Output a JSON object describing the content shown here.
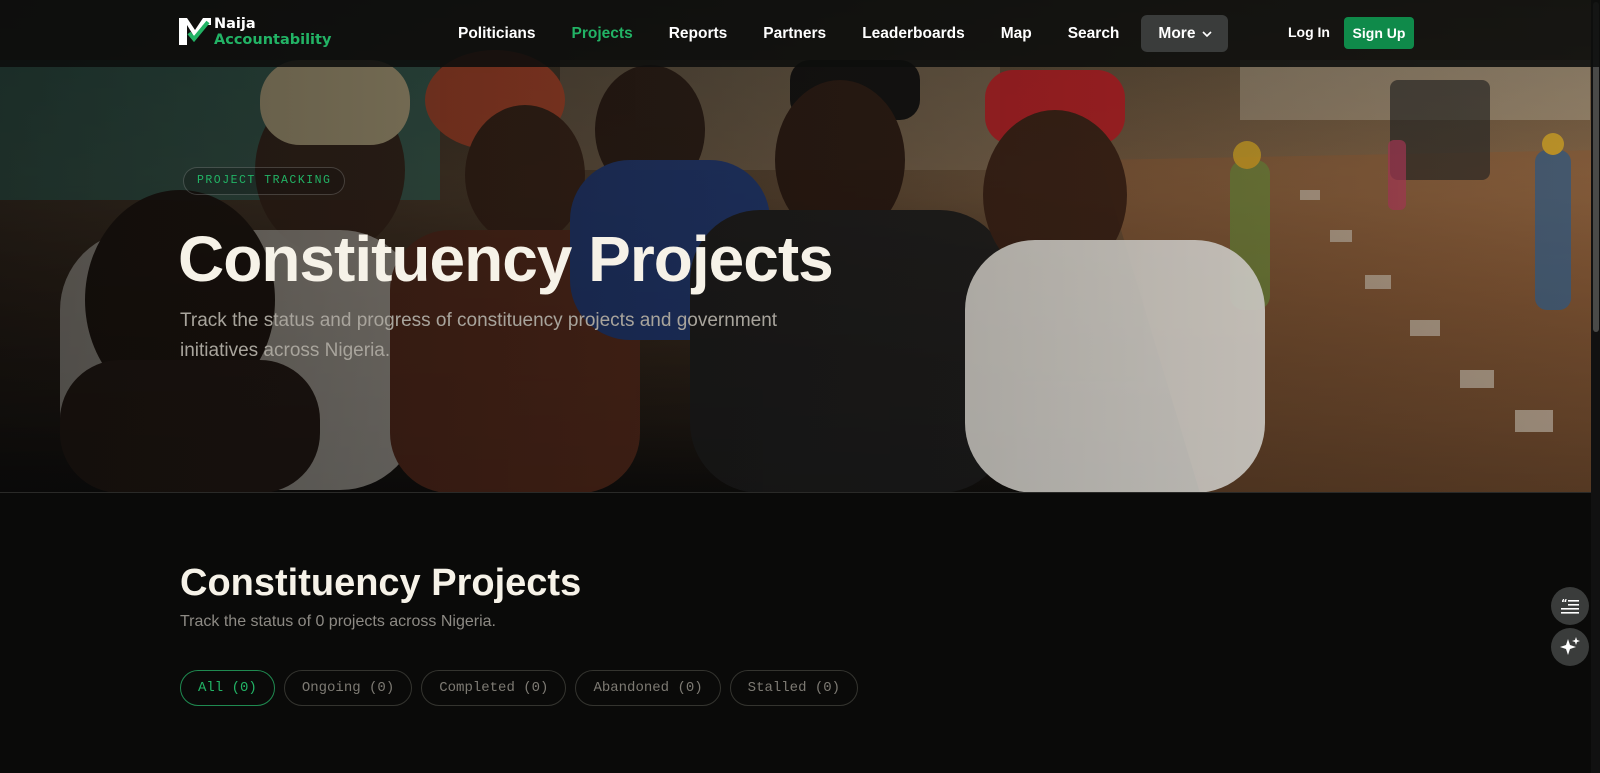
{
  "brand": {
    "line1": "Naija",
    "line2": "Accountability"
  },
  "nav": {
    "links": [
      {
        "label": "Politicians",
        "active": false
      },
      {
        "label": "Projects",
        "active": true
      },
      {
        "label": "Reports",
        "active": false
      },
      {
        "label": "Partners",
        "active": false
      },
      {
        "label": "Leaderboards",
        "active": false
      },
      {
        "label": "Map",
        "active": false
      },
      {
        "label": "Search",
        "active": false
      }
    ],
    "more_label": "More",
    "login_label": "Log In",
    "signup_label": "Sign Up"
  },
  "hero": {
    "badge": "PROJECT TRACKING",
    "title": "Constituency Projects",
    "subtitle": "Track the status and progress of constituency projects and government initiatives across Nigeria."
  },
  "section": {
    "title": "Constituency Projects",
    "subtitle": "Track the status of 0 projects across Nigeria."
  },
  "filters": [
    {
      "label": "All (0)",
      "active": true
    },
    {
      "label": "Ongoing (0)",
      "active": false
    },
    {
      "label": "Completed (0)",
      "active": false
    },
    {
      "label": "Abandoned (0)",
      "active": false
    },
    {
      "label": "Stalled (0)",
      "active": false
    }
  ],
  "floating_buttons": [
    {
      "icon": "quote-list-icon"
    },
    {
      "icon": "sparkle-icon"
    }
  ],
  "colors": {
    "accent": "#22b365",
    "signup_bg": "#0f8a4a",
    "page_bg": "#0a0a09"
  }
}
